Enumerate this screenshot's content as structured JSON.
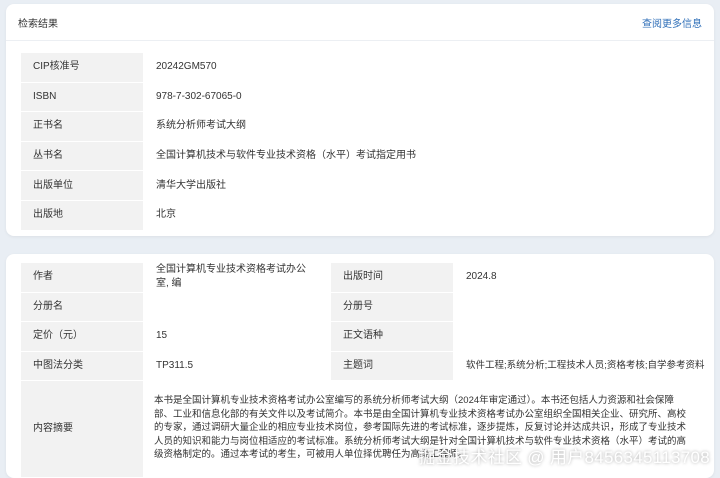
{
  "result_card": {
    "title": "检索结果",
    "more_link": "查阅更多信息",
    "rows": [
      {
        "label": "CIP核准号",
        "value": "20242GM570"
      },
      {
        "label": "ISBN",
        "value": "978-7-302-67065-0"
      },
      {
        "label": "正书名",
        "value": "系统分析师考试大纲"
      },
      {
        "label": "丛书名",
        "value": "全国计算机技术与软件专业技术资格（水平）考试指定用书"
      },
      {
        "label": "出版单位",
        "value": "清华大学出版社"
      },
      {
        "label": "出版地",
        "value": "北京"
      }
    ]
  },
  "detail_card": {
    "rows": [
      {
        "label_a": "作者",
        "value_a": "全国计算机专业技术资格考试办公室, 编",
        "label_b": "出版时间",
        "value_b": "2024.8"
      },
      {
        "label_a": "分册名",
        "value_a": "",
        "label_b": "分册号",
        "value_b": ""
      },
      {
        "label_a": "定价（元）",
        "value_a": "15",
        "label_b": "正文语种",
        "value_b": ""
      },
      {
        "label_a": "中图法分类",
        "value_a": "TP311.5",
        "label_b": "主题词",
        "value_b": "软件工程;系统分析;工程技术人员;资格考核;自学参考资料"
      }
    ],
    "summary_label": "内容摘要",
    "summary_text": "本书是全国计算机专业技术资格考试办公室编写的系统分析师考试大纲（2024年审定通过）。本书还包括人力资源和社会保障部、工业和信息化部的有关文件以及考试简介。本书是由全国计算机专业技术资格考试办公室组织全国相关企业、研究所、高校的专家，通过调研大量企业的相应专业技术岗位，参考国际先进的考试标准，逐步提炼，反复讨论并达成共识，形成了专业技术人员的知识和能力与岗位相适应的考试标准。系统分析师考试大纲是针对全国计算机技术与软件专业技术资格（水平）考试的高级资格制定的。通过本考试的考生，可被用人单位择优聘任为高级工程师。"
  },
  "watermark": "掘金技术社区 @ 用户8456345113708"
}
